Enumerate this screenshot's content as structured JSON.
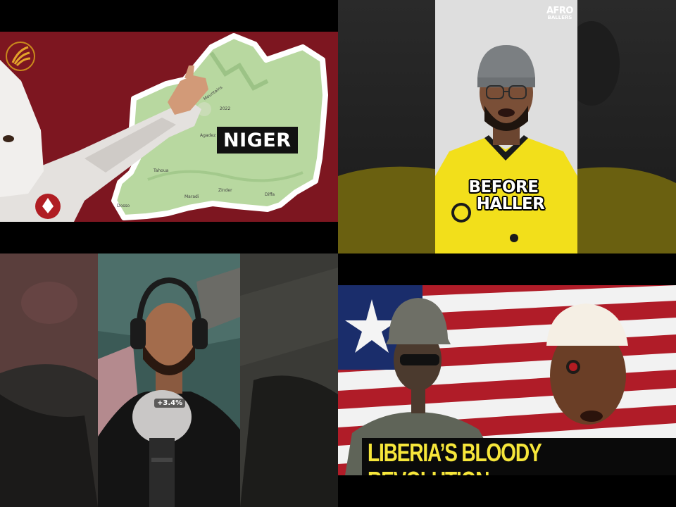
{
  "tiles": {
    "top_left": {
      "label": "NIGER",
      "map_towns": [
        "Agadez",
        "Tahoua",
        "Maradi",
        "Zinder",
        "Diffa",
        "Dosso",
        "Mountains",
        "2022"
      ],
      "logo_icon": "sunburst-logo-icon"
    },
    "top_right": {
      "brand_line1": "AFRO",
      "brand_line2": "BALLERS",
      "caption_line1": "BEFORE",
      "caption_line2": "HALLER"
    },
    "bottom_left": {
      "stat": "+3.4%"
    },
    "bottom_right": {
      "title": "LIBERIA’S BLOODY REVOLUTION"
    }
  },
  "colors": {
    "niger_bg": "#7d1620",
    "map_green": "#b8d8a0",
    "jersey_yellow": "#f2df1b",
    "liberia_red": "#b01c28",
    "liberia_blue": "#1a2d6b",
    "title_yellow": "#f6e63a"
  }
}
